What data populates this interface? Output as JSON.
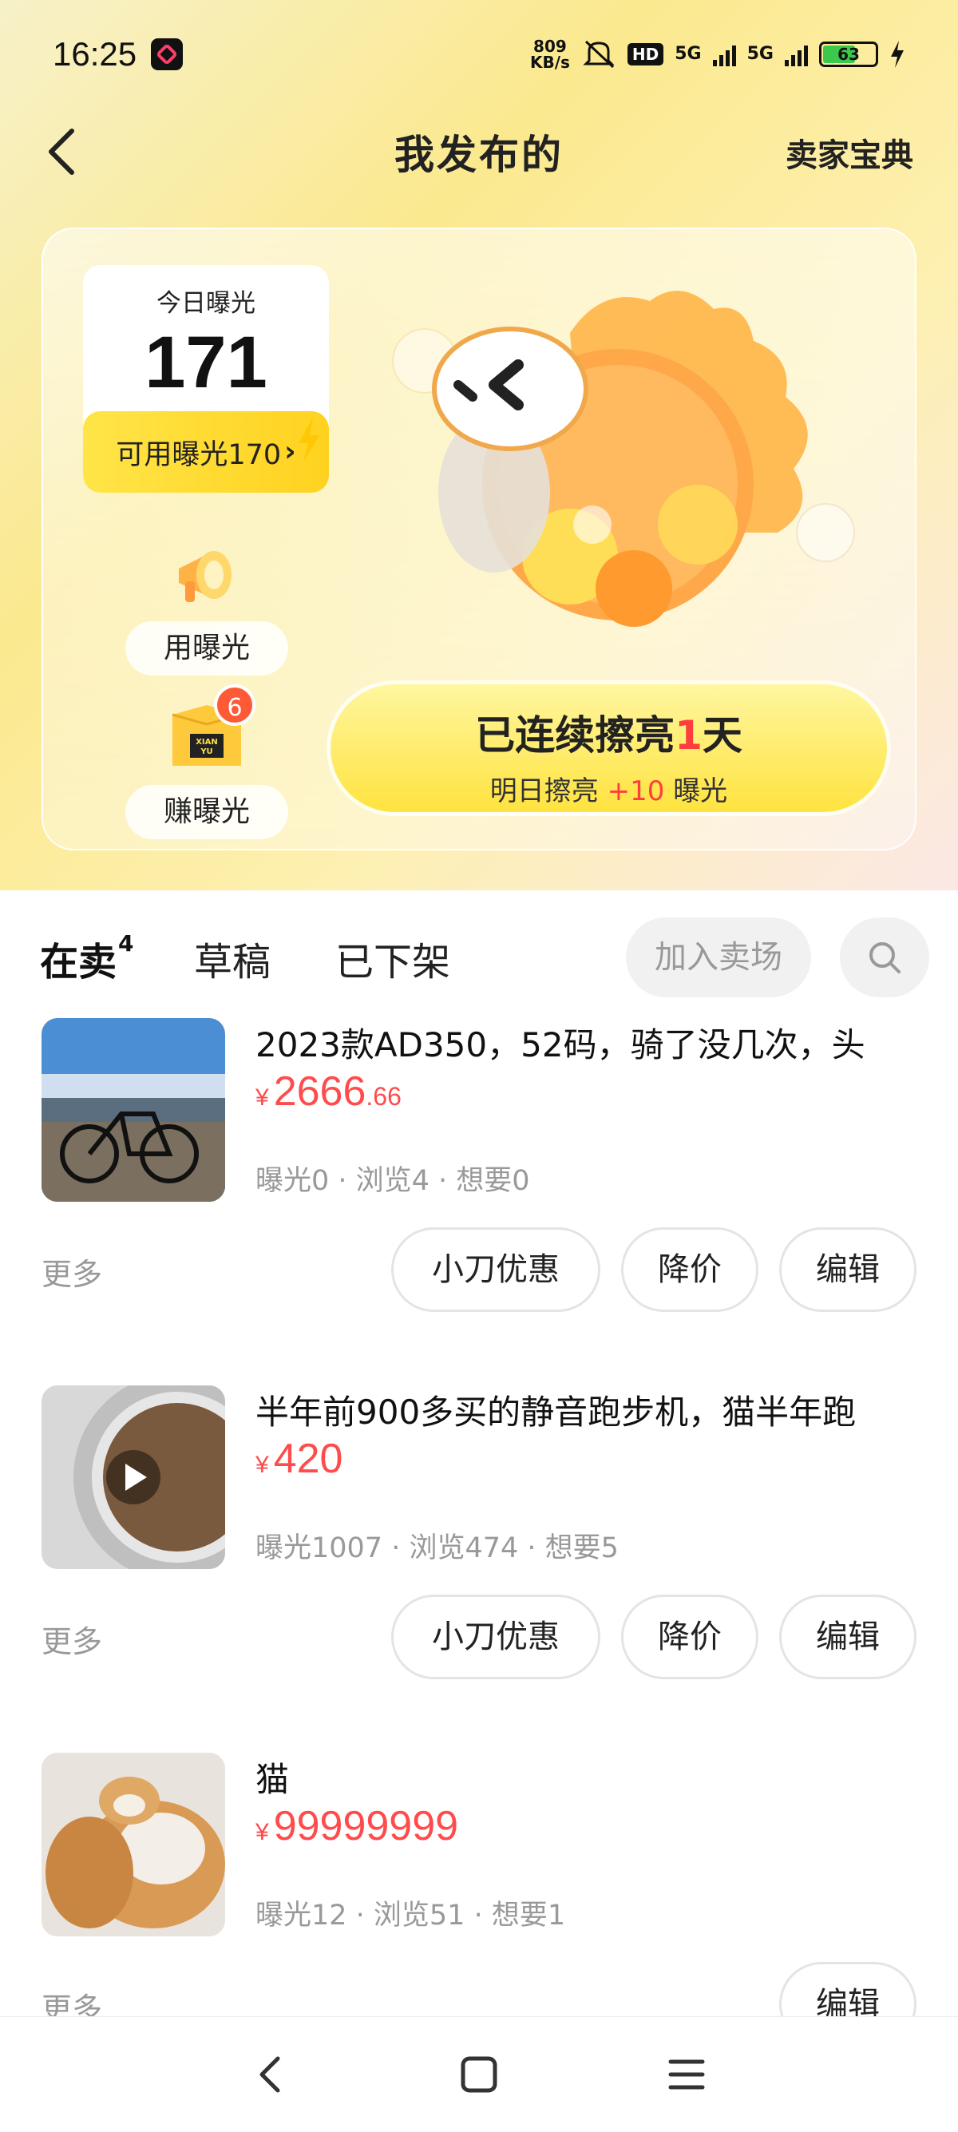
{
  "status_bar": {
    "time": "16:25",
    "net_speed_value": "809",
    "net_speed_unit": "KB/s",
    "hd": "HD",
    "sig1": "5G",
    "sig2": "5G",
    "battery": "63"
  },
  "header": {
    "title": "我发布的",
    "seller_guide": "卖家宝典"
  },
  "exposure": {
    "today_label": "今日曝光",
    "today_value": "171",
    "available_label": "可用曝光170",
    "use_label": "用曝光",
    "earn_label": "赚曝光",
    "earn_badge": "6",
    "box_text": "XIAN YU",
    "streak_prefix": "已连续擦亮",
    "streak_days": "1",
    "streak_suffix": "天",
    "tomorrow_prefix": "明日擦亮",
    "tomorrow_bonus": "+10",
    "tomorrow_suffix": "曝光"
  },
  "tabs": {
    "on_sale": "在卖",
    "on_sale_count": "4",
    "drafts": "草稿",
    "removed": "已下架",
    "join_market": "加入卖场"
  },
  "items": [
    {
      "title": "2023款AD350，52码，骑了没几次，头",
      "currency": "¥",
      "price_int": "2666",
      "price_dec": ".66",
      "stats": "曝光0 · 浏览4 · 想要0",
      "more": "更多",
      "btn_discount": "小刀优惠",
      "btn_reduce": "降价",
      "btn_edit": "编辑"
    },
    {
      "title": "半年前900多买的静音跑步机，猫半年跑",
      "currency": "¥",
      "price_int": "420",
      "price_dec": "",
      "stats": "曝光1007 · 浏览474 · 想要5",
      "more": "更多",
      "btn_discount": "小刀优惠",
      "btn_reduce": "降价",
      "btn_edit": "编辑"
    },
    {
      "title": "猫",
      "currency": "¥",
      "price_int": "99999999",
      "price_dec": "",
      "stats": "曝光12 · 浏览51 · 想要1",
      "more": "更多",
      "btn_edit": "编辑"
    }
  ],
  "colors": {
    "accent_yellow": "#ffe11f",
    "price_red": "#ff4b4b"
  },
  "icons": [
    "back-arrow-icon",
    "megaphone-icon",
    "gift-box-icon",
    "search-icon",
    "play-icon",
    "nav-back-icon",
    "nav-home-icon",
    "nav-menu-icon"
  ]
}
